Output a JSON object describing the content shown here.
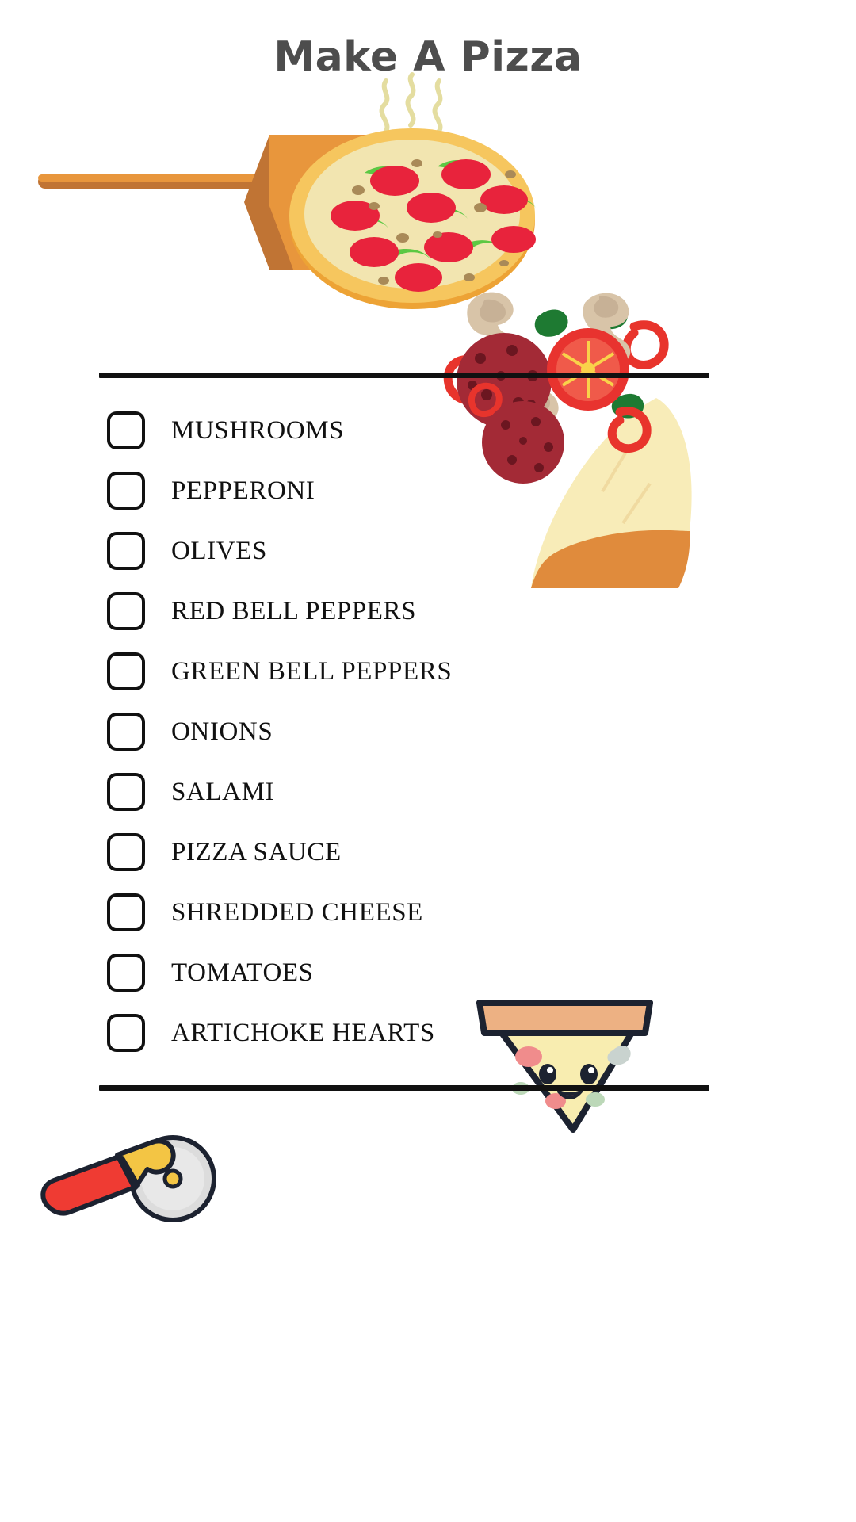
{
  "page": {
    "title": "Make A Pizza",
    "background_color": "#ffffff",
    "title_color": "#4d4d4d",
    "rule_color": "#111111"
  },
  "checklist": {
    "checkbox_state": "unchecked",
    "items": [
      {
        "label": "MUSHROOMS"
      },
      {
        "label": "PEPPERONI"
      },
      {
        "label": "OLIVES"
      },
      {
        "label": "RED BELL PEPPERS"
      },
      {
        "label": "GREEN BELL PEPPERS"
      },
      {
        "label": "ONIONS"
      },
      {
        "label": "SALAMI"
      },
      {
        "label": "PIZZA SAUCE"
      },
      {
        "label": "SHREDDED CHEESE"
      },
      {
        "label": "TOMATOES"
      },
      {
        "label": "ARTICHOKE HEARTS"
      }
    ]
  },
  "illustrations": [
    {
      "name": "pizza-peel-illustration",
      "description": "Whole pepperoni pizza on a wooden peel with steam",
      "colors": {
        "peel_light": "#e8963c",
        "peel_dark": "#c07434",
        "crust_outer": "#f0a93a",
        "crust_inner": "#f5c960",
        "cheese": "#f2e5b0",
        "pepperoni": "#e8233c",
        "pepper_green": "#5cc843",
        "mushroom_bit": "#a98a58",
        "steam": "#e8e2a0"
      }
    },
    {
      "name": "toppings-collage-illustration",
      "description": "Salami slices, tomato slice, mushrooms, basil, red pepper rings and a cheese slice",
      "colors": {
        "salami": "#a32a36",
        "salami_dot": "#6b1620",
        "tomato": "#e8332f",
        "mushroom": "#d8c4a8",
        "basil": "#1e7a32",
        "pepper_ring": "#e8342c",
        "cheese_slice": "#f7e7a8",
        "slice_crust": "#e08b3c"
      }
    },
    {
      "name": "kawaii-pizza-slice-illustration",
      "description": "Smiling cartoon pizza slice with eyes and mouth",
      "colors": {
        "crust": "#edb183",
        "cheese": "#f8edb0",
        "outline": "#1c2230",
        "pepperoni": "#f08c8c",
        "olive": "#bcd8b8",
        "mushroom": "#c9d3cf"
      }
    },
    {
      "name": "pizza-cutter-illustration",
      "description": "Pizza cutter wheel with red and yellow handle",
      "colors": {
        "handle_red": "#ef3b33",
        "handle_yellow": "#f3c544",
        "wheel": "#dcdcdc",
        "outline": "#1c2230"
      }
    }
  ]
}
